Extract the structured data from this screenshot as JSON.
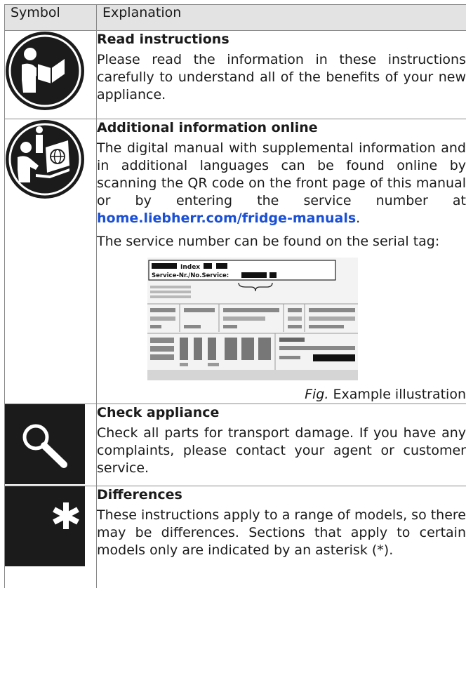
{
  "header": {
    "symbol": "Symbol",
    "explanation": "Explanation"
  },
  "rows": [
    {
      "icon": "read-instructions-icon",
      "title": "Read instructions",
      "text": "Please read the information in these instructions carefully to understand all of the benefits of your new appliance."
    },
    {
      "icon": "online-info-icon",
      "title": "Additional information online",
      "text_before_link": "The digital manual with supplemental information and in additional languages can be found online by scanning the QR code on the front page of this manual or by entering the service number at ",
      "link": "home.liebherr.com/fridge-manuals",
      "text_after_link": ".",
      "text2": "The service number can be found on the serial tag:",
      "figure": {
        "label_index": "Index",
        "label_service": "Service-Nr./No.Service:"
      },
      "caption_prefix": "Fig.",
      "caption": "Example illustration"
    },
    {
      "icon": "magnifier-icon",
      "title": "Check appliance",
      "text": "Check all parts for transport damage. If you have any complaints, please contact your agent or customer service."
    },
    {
      "icon": "asterisk-icon",
      "title": "Differences",
      "text": "These instructions apply to a range of models, so there may be differences. Sections that apply to certain models only are indicated by an asterisk (*)."
    }
  ],
  "colors": {
    "icon_bg": "#1b1b1b",
    "link": "#1a4fd6",
    "header_bg": "#e3e3e3"
  }
}
